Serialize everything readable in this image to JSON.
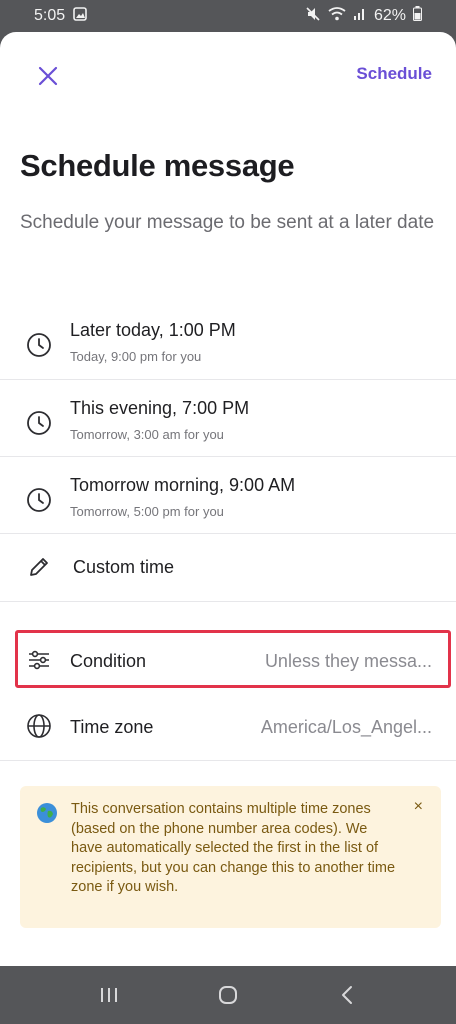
{
  "status_bar": {
    "time": "5:05",
    "battery": "62%"
  },
  "header": {
    "schedule_label": "Schedule"
  },
  "title": "Schedule message",
  "subtitle": "Schedule your message to be sent at a later date",
  "options": [
    {
      "label": "Later today, 1:00 PM",
      "sub": "Today, 9:00 pm for you"
    },
    {
      "label": "This evening, 7:00 PM",
      "sub": "Tomorrow, 3:00 am for you"
    },
    {
      "label": "Tomorrow morning, 9:00 AM",
      "sub": "Tomorrow, 5:00 pm for you"
    }
  ],
  "custom_time": {
    "label": "Custom time"
  },
  "condition": {
    "label": "Condition",
    "value": "Unless they messa..."
  },
  "timezone": {
    "label": "Time zone",
    "value": "America/Los_Angel..."
  },
  "notice": {
    "text": "This conversation contains multiple time zones (based on the phone number area codes). We have automatically selected the first in the list of recipients, but you can change this to another time zone if you wish.",
    "close": "×"
  },
  "colors": {
    "accent": "#6a4fd6",
    "highlight": "#e2334a",
    "notice_bg": "#fdf3de"
  }
}
